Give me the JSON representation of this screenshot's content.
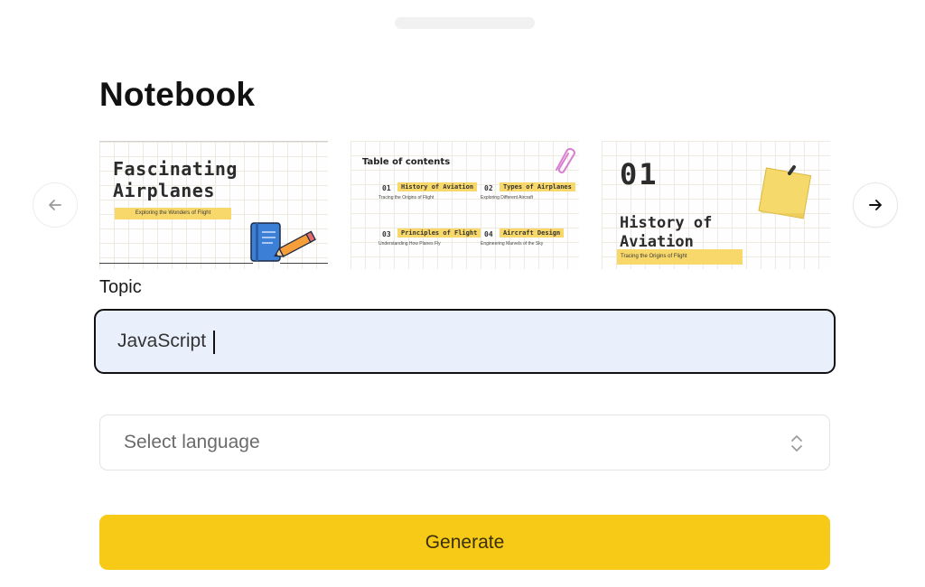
{
  "page": {
    "title": "Notebook"
  },
  "carousel": {
    "prev_icon": "arrow-left-icon",
    "next_icon": "arrow-right-icon",
    "slides": [
      {
        "title": "Fascinating\nAirplanes",
        "subtitle": "Exploring the Wonders of Flight",
        "decoration": "notebook-and-pencil-icon"
      },
      {
        "heading": "Table of contents",
        "decoration": "paperclip-icon",
        "items": [
          {
            "num": "01",
            "label": "History of Aviation",
            "desc": "Tracing the Origins of Flight"
          },
          {
            "num": "02",
            "label": "Types of Airplanes",
            "desc": "Exploring Different Aircraft"
          },
          {
            "num": "03",
            "label": "Principles of Flight",
            "desc": "Understanding How Planes Fly"
          },
          {
            "num": "04",
            "label": "Aircraft Design",
            "desc": "Engineering Marvels of the Sky"
          }
        ]
      },
      {
        "number": "01",
        "title": "History of\nAviation",
        "subtitle": "Tracing the Origins of Flight",
        "decoration": "sticky-note-icon"
      }
    ]
  },
  "form": {
    "topic_label": "Topic",
    "topic_value": "JavaScript",
    "language_placeholder": "Select language",
    "language_icon": "chevron-up-down-icon",
    "generate_label": "Generate"
  },
  "colors": {
    "accent": "#f7ca18",
    "input_bg": "#e9f0fc",
    "highlight": "#f8d86a"
  }
}
